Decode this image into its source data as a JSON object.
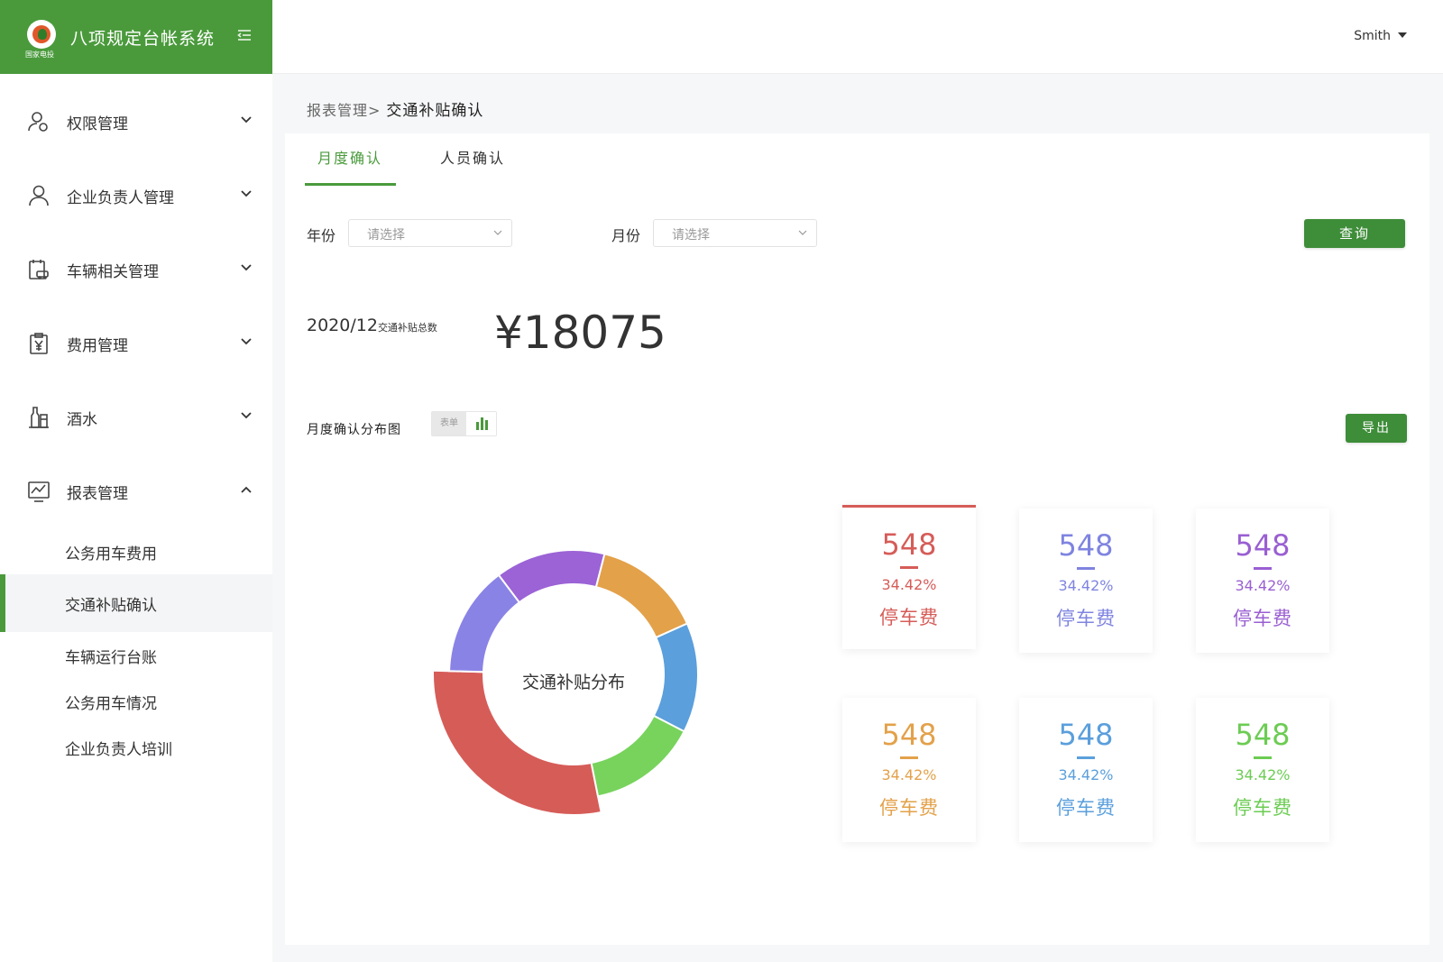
{
  "app": {
    "title": "八项规定台帐系统",
    "logo_sub": "国家电投"
  },
  "topbar": {
    "user": "Smith"
  },
  "sidebar": {
    "items": [
      {
        "label": "权限管理",
        "icon": "user-permission-icon",
        "expanded": false
      },
      {
        "label": "企业负责人管理",
        "icon": "person-icon",
        "expanded": false
      },
      {
        "label": "车辆相关管理",
        "icon": "vehicle-doc-icon",
        "expanded": false
      },
      {
        "label": "费用管理",
        "icon": "yuan-doc-icon",
        "expanded": false
      },
      {
        "label": "酒水",
        "icon": "bottle-icon",
        "expanded": false
      },
      {
        "label": "报表管理",
        "icon": "chart-line-icon",
        "expanded": true
      }
    ],
    "subitems": [
      {
        "label": "公务用车费用",
        "active": false
      },
      {
        "label": "交通补贴确认",
        "active": true
      },
      {
        "label": "车辆运行台账",
        "active": false
      },
      {
        "label": "公务用车情况",
        "active": false
      },
      {
        "label": "企业负责人培训",
        "active": false
      }
    ]
  },
  "breadcrumb": {
    "parent": "报表管理>",
    "current": "交通补贴确认"
  },
  "tabs": [
    {
      "label": "月度确认",
      "active": true
    },
    {
      "label": "人员确认",
      "active": false
    }
  ],
  "filters": {
    "year_label": "年份",
    "year_placeholder": "请选择",
    "month_label": "月份",
    "month_placeholder": "请选择",
    "query_button": "查询"
  },
  "summary": {
    "period": "2020/12",
    "caption": "交通补贴总数",
    "total": "¥18075"
  },
  "distribution": {
    "label": "月度确认分布图",
    "toggle_table": "表单",
    "export_button": "导出"
  },
  "chart_data": {
    "type": "pie",
    "title": "交通补贴分布",
    "slices": [
      {
        "value": 12.5,
        "color": "#8a83e6"
      },
      {
        "value": 12.5,
        "color": "#9b63d6"
      },
      {
        "value": 12.5,
        "color": "#e3a14a"
      },
      {
        "value": 12.5,
        "color": "#5b9fdc"
      },
      {
        "value": 12.5,
        "color": "#77d35c"
      },
      {
        "value": 25.0,
        "color": "#d65c58"
      }
    ],
    "highlighted_index": 5
  },
  "stats": [
    {
      "value": "548",
      "pct": "34.42%",
      "label": "停车费",
      "color": "#d65c58",
      "active": true
    },
    {
      "value": "548",
      "pct": "34.42%",
      "label": "停车费",
      "color": "#7f84e0",
      "active": false
    },
    {
      "value": "548",
      "pct": "34.42%",
      "label": "停车费",
      "color": "#9a5fd2",
      "active": false
    },
    {
      "value": "548",
      "pct": "34.42%",
      "label": "停车费",
      "color": "#e3a14a",
      "active": false
    },
    {
      "value": "548",
      "pct": "34.42%",
      "label": "停车费",
      "color": "#5b9fdc",
      "active": false
    },
    {
      "value": "548",
      "pct": "34.42%",
      "label": "停车费",
      "color": "#6ccc53",
      "active": false
    }
  ]
}
